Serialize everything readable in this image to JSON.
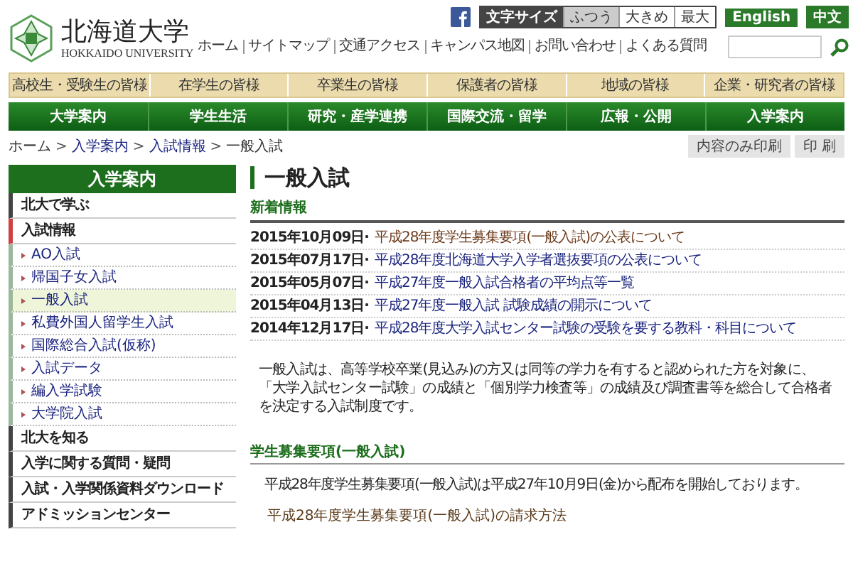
{
  "header": {
    "logo": {
      "name": "北海道大学",
      "subtitle": "HOKKAIDO UNIVERSITY"
    },
    "text_size": {
      "label": "文字サイズ",
      "options": [
        {
          "label": "ふつう",
          "selected": true
        },
        {
          "label": "大きめ",
          "selected": false
        },
        {
          "label": "最大",
          "selected": false
        }
      ]
    },
    "languages": [
      "English",
      "中文"
    ],
    "utility_links": [
      "ホーム",
      "サイトマップ",
      "交通アクセス",
      "キャンパス地図",
      "お問い合わせ",
      "よくある質問"
    ]
  },
  "audience_nav": [
    "高校生・受験生の皆様",
    "在学生の皆様",
    "卒業生の皆様",
    "保護者の皆様",
    "地域の皆様",
    "企業・研究者の皆様"
  ],
  "main_nav": [
    "大学案内",
    "学生生活",
    "研究・産学連携",
    "国際交流・留学",
    "広報・公開",
    "入学案内"
  ],
  "breadcrumb": {
    "separator": ">",
    "items": [
      "ホーム",
      "入学案内",
      "入試情報",
      "一般入試"
    ]
  },
  "print_buttons": [
    "内容のみ印刷",
    "印 刷"
  ],
  "sidebar": {
    "title": "入学案内",
    "items": [
      {
        "label": "北大で学ぶ",
        "selected": false
      },
      {
        "label": "入試情報",
        "selected": true,
        "children": [
          {
            "label": "AO入試",
            "selected": false
          },
          {
            "label": "帰国子女入試",
            "selected": false
          },
          {
            "label": "一般入試",
            "selected": true
          },
          {
            "label": "私費外国人留学生入試",
            "selected": false
          },
          {
            "label": "国際総合入試(仮称)",
            "selected": false
          },
          {
            "label": "入試データ",
            "selected": false
          },
          {
            "label": "編入学試験",
            "selected": false
          },
          {
            "label": "大学院入試",
            "selected": false
          }
        ]
      },
      {
        "label": "北大を知る",
        "selected": false
      },
      {
        "label": "入学に関する質問・疑問",
        "selected": false
      },
      {
        "label": "入試・入学関係資料ダウンロード",
        "selected": false
      },
      {
        "label": "アドミッションセンター",
        "selected": false
      }
    ]
  },
  "content": {
    "title": "一般入試",
    "news": {
      "heading": "新着情報",
      "items": [
        {
          "date": "2015年10月09日·",
          "title": "平成28年度学生募集要項(一般入試)の公表について",
          "visited": true
        },
        {
          "date": "2015年07月17日·",
          "title": "平成28年度北海道大学入学者選抜要項の公表について",
          "visited": false
        },
        {
          "date": "2015年05月07日·",
          "title": "平成27年度一般入試合格者の平均点等一覧",
          "visited": false
        },
        {
          "date": "2015年04月13日·",
          "title": "平成27年度一般入試 試験成績の開示について",
          "visited": false
        },
        {
          "date": "2014年12月17日·",
          "title": "平成28年度大学入試センター試験の受験を要する教科・科目について",
          "visited": false
        }
      ]
    },
    "intro": "一般入試は、高等学校卒業(見込み)の方又は同等の学力を有すると認められた方を対象に、「大学入試センター試験」の成績と「個別学力検査等」の成績及び調査書等を総合して合格者を決定する入試制度です。",
    "section": {
      "heading": "学生募集要項(一般入試)",
      "text": "平成28年度学生募集要項(一般入試)は平成27年10月9日(金)から配布を開始しております。",
      "link": "平成28年度学生募集要項(一般入試)の請求方法"
    }
  }
}
